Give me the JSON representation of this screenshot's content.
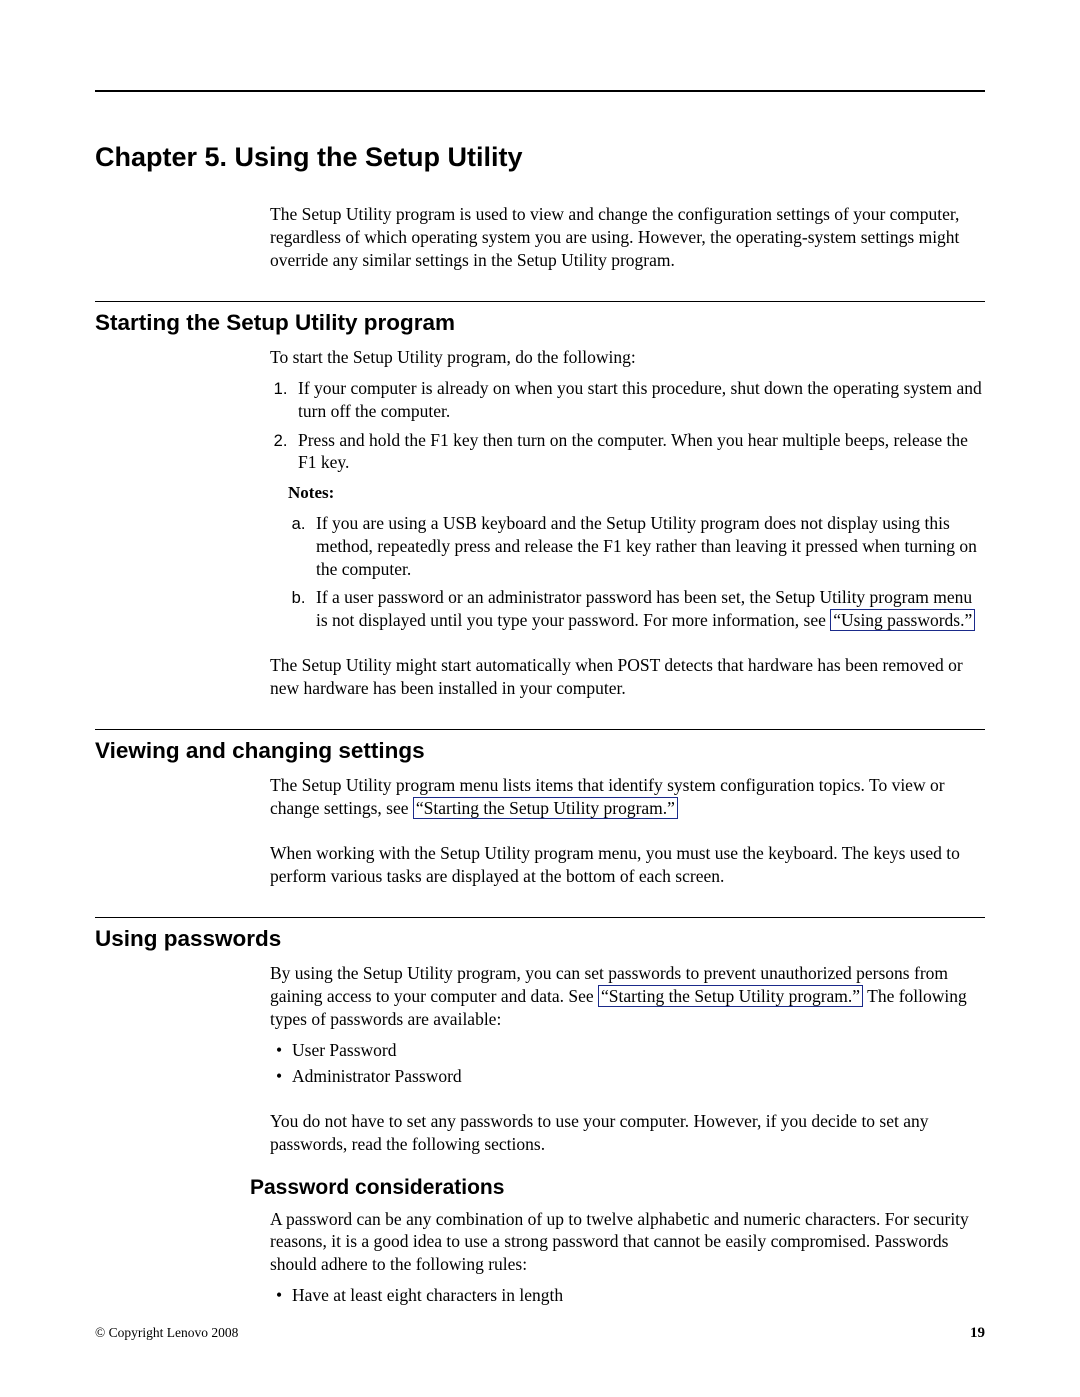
{
  "chapter_title": "Chapter 5. Using the Setup Utility",
  "intro": "The Setup Utility program is used to view and change the configuration settings of your computer, regardless of which operating system you are using. However, the operating-system settings might override any similar settings in the Setup Utility program.",
  "section1": {
    "heading": "Starting the Setup Utility program",
    "lead": "To start the Setup Utility program, do the following:",
    "steps": [
      "If your computer is already on when you start this procedure, shut down the operating system and turn off the computer.",
      "Press and hold the F1 key then turn on the computer. When you hear multiple beeps, release the F1 key."
    ],
    "notes_label": "Notes:",
    "notes": {
      "a": "If you are using a USB keyboard and the Setup Utility program does not display using this method, repeatedly press and release the F1 key rather than leaving it pressed when turning on the computer.",
      "b_pre": "If a user password or an administrator password has been set, the Setup Utility program menu is not displayed until you type your password. For more information, see ",
      "b_link": "“Using passwords.”"
    },
    "after": "The Setup Utility might start automatically when POST detects that hardware has been removed or new hardware has been installed in your computer."
  },
  "section2": {
    "heading": "Viewing and changing settings",
    "p1_pre": "The Setup Utility program menu lists items that identify system configuration topics. To view or change settings, see ",
    "p1_link": "“Starting the Setup Utility program.”",
    "p2": "When working with the Setup Utility program menu, you must use the keyboard. The keys used to perform various tasks are displayed at the bottom of each screen."
  },
  "section3": {
    "heading": "Using passwords",
    "p1_pre": "By using the Setup Utility program, you can set passwords to prevent unauthorized persons from gaining access to your computer and data. See ",
    "p1_link": "“Starting the Setup Utility program.”",
    "p1_post": " The following types of passwords are available:",
    "bullets": [
      "User Password",
      "Administrator Password"
    ],
    "p2": "You do not have to set any passwords to use your computer. However, if you decide to set any passwords, read the following sections.",
    "sub": {
      "heading": "Password considerations",
      "p1": "A password can be any combination of up to twelve alphabetic and numeric characters. For security reasons, it is a good idea to use a strong password that cannot be easily compromised. Passwords should adhere to the following rules:",
      "bullets": [
        "Have at least eight characters in length"
      ]
    }
  },
  "footer": {
    "copyright": "© Copyright Lenovo 2008",
    "page": "19"
  }
}
